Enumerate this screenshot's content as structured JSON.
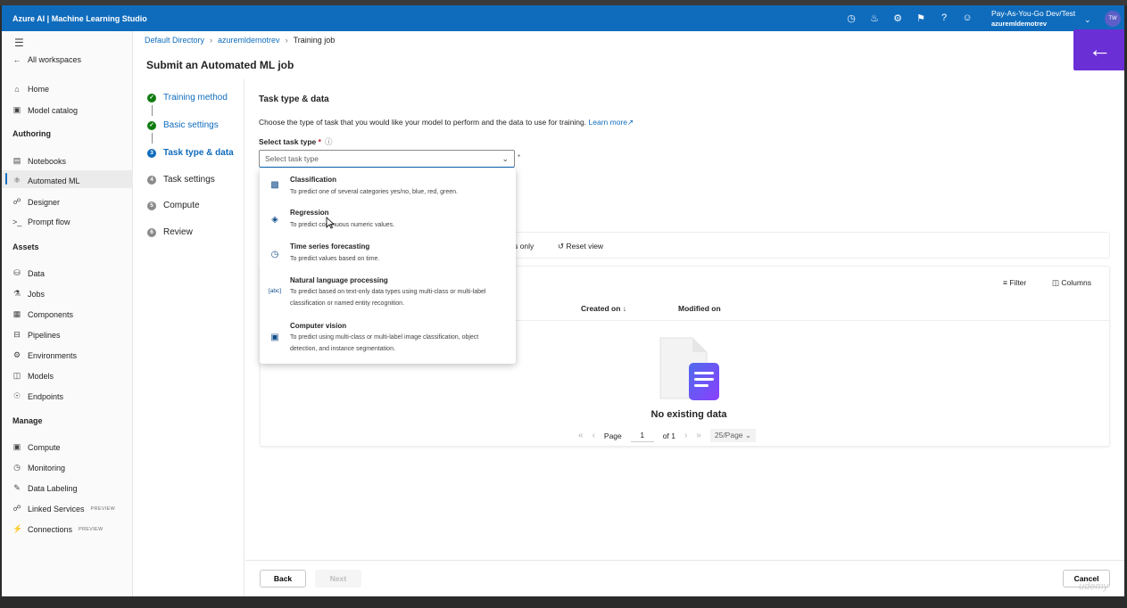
{
  "app": {
    "title": "Azure AI | Machine Learning Studio",
    "account_name": "Pay-As-You-Go Dev/Test",
    "account_workspace": "azuremldemotrev",
    "avatar_initials": "TW",
    "accent": "#0f6cbd",
    "fab_color": "#6b2fd6"
  },
  "sidebar": {
    "all_workspaces": "All workspaces",
    "home": "Home",
    "model_catalog": "Model catalog",
    "authoring": "Authoring",
    "notebooks": "Notebooks",
    "automated_ml": "Automated ML",
    "designer": "Designer",
    "prompt_flow": "Prompt flow",
    "assets": "Assets",
    "data": "Data",
    "jobs": "Jobs",
    "components": "Components",
    "pipelines": "Pipelines",
    "environments": "Environments",
    "models": "Models",
    "endpoints": "Endpoints",
    "manage": "Manage",
    "compute": "Compute",
    "monitoring": "Monitoring",
    "data_labeling": "Data Labeling",
    "linked_services": "Linked Services",
    "connections": "Connections",
    "preview_badge": "PREVIEW"
  },
  "breadcrumb": {
    "item1": "Default Directory",
    "item2": "azuremldemotrev",
    "item3": "Training job"
  },
  "page_title": "Submit an Automated ML job",
  "steps": {
    "s1": "Training method",
    "s2": "Basic settings",
    "s3": "Task type & data",
    "s4": "Task settings",
    "s5": "Compute",
    "s6": "Review",
    "n3": "3",
    "n4": "4",
    "n5": "5",
    "n6": "6"
  },
  "main": {
    "section_title": "Task type & data",
    "description": "Choose the type of task that you would like your model to perform and the data to use for training.",
    "learn_more": "Learn more",
    "task_label": "Select task type",
    "task_placeholder": "Select task type"
  },
  "dropdown": {
    "options": [
      {
        "title": "Classification",
        "desc": "To predict one of several categories yes/no, blue, red, green.",
        "icon": "bar-chart-icon"
      },
      {
        "title": "Regression",
        "desc": "To predict continuous numeric values.",
        "icon": "layers-icon"
      },
      {
        "title": "Time series forecasting",
        "desc": "To predict values based on time.",
        "icon": "clock-icon"
      },
      {
        "title": "Natural language processing",
        "desc": "To predict based on text-only data types using multi-class or multi-label classification or named entity recognition.",
        "icon": "text-abc-icon"
      },
      {
        "title": "Computer vision",
        "desc": "To predict using multi-class or multi-label image classification, object detection, and instance segmentation.",
        "icon": "image-icon"
      }
    ]
  },
  "table": {
    "datasets_only": "ets only",
    "reset_view": "Reset view",
    "filter": "Filter",
    "columns": "Columns",
    "col_created": "Created on",
    "col_modified": "Modified on",
    "empty": "No existing data",
    "page_label": "Page",
    "page_value": "1",
    "page_of": "of 1",
    "page_size": "25/Page"
  },
  "footer": {
    "back": "Back",
    "next": "Next",
    "cancel": "Cancel"
  },
  "watermark": "udemy"
}
